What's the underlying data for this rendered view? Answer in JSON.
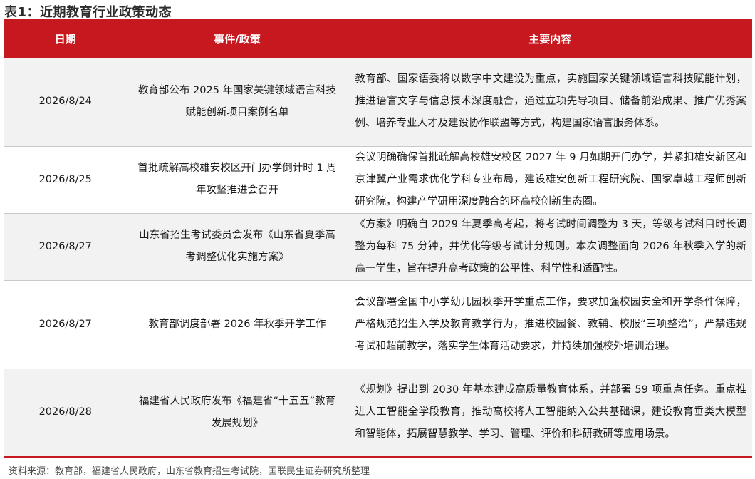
{
  "title": "表1：近期教育行业政策动态",
  "table": {
    "headers": [
      "日期",
      "事件/政策",
      "主要内容"
    ],
    "rows": [
      {
        "date": "2026/8/24",
        "event": "教育部公布 2025 年国家关键领域语言科技赋能创新项目案例名单",
        "content": "教育部、国家语委将以数字中文建设为重点，实施国家关键领域语言科技赋能计划，推进语言文字与信息技术深度融合，通过立项先导项目、储备前沿成果、推广优秀案例、培养专业人才及建设协作联盟等方式，构建国家语言服务体系。"
      },
      {
        "date": "2026/8/25",
        "event": "首批疏解高校雄安校区开门办学倒计时 1 周年攻坚推进会召开",
        "content": "会议明确确保首批疏解高校雄安校区 2027 年 9 月如期开门办学，并紧扣雄安新区和京津冀产业需求优化学科专业布局，建设雄安创新工程研究院、国家卓越工程师创新研究院，构建产学研用深度融合的环高校创新生态圈。"
      },
      {
        "date": "2026/8/27",
        "event": "山东省招生考试委员会发布《山东省夏季高考调整优化实施方案》",
        "content": "《方案》明确自 2029 年夏季高考起，将考试时间调整为 3 天，等级考试科目时长调整为每科 75 分钟，并优化等级考试计分规则。本次调整面向 2026 年秋季入学的新高一学生，旨在提升高考政策的公平性、科学性和适配性。"
      },
      {
        "date": "2026/8/27",
        "event": "教育部调度部署 2026 年秋季开学工作",
        "content": "会议部署全国中小学幼儿园秋季开学重点工作，要求加强校园安全和开学条件保障，严格规范招生入学及教育教学行为，推进校园餐、教辅、校服“三项整治”，严禁违规考试和超前教学，落实学生体育活动要求，并持续加强校外培训治理。"
      },
      {
        "date": "2026/8/28",
        "event": "福建省人民政府发布《福建省“十五五”教育发展规划》",
        "content": "《规划》提出到 2030 年基本建成高质量教育体系，并部署 59 项重点任务。重点推进人工智能全学段教育，推动高校将人工智能纳入公共基础课，建设教育垂类大模型和智能体，拓展智慧教学、学习、管理、评价和科研教研等应用场景。"
      }
    ]
  },
  "source": "资料来源：教育部，福建省人民政府，山东省教育招生考试院，国联民生证券研究所整理",
  "colors": {
    "header_bg": "#c8181f",
    "header_text": "#ffffff",
    "stripe": "#f2f2f2"
  }
}
